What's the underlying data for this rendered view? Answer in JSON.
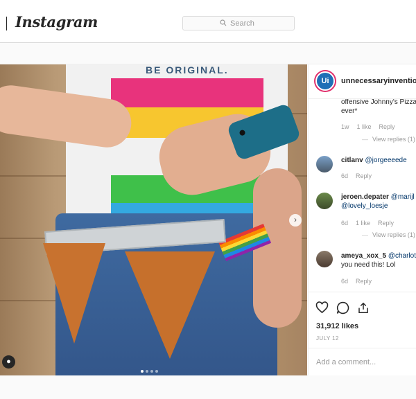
{
  "header": {
    "logo": "Instagram",
    "search_placeholder": "Search",
    "search_icon": "search-icon"
  },
  "post": {
    "shirt_text": "BE ORIGINAL.",
    "carousel": {
      "total": 4,
      "active": 1
    }
  },
  "panel": {
    "avatar_text": "Ui",
    "username": "unnecessaryinventions",
    "comments": [
      {
        "line1": "offensive Johnny's Pizza",
        "line2": "ever*",
        "time": "1w",
        "likes": "1 like",
        "reply": "Reply",
        "view_replies": "View replies (1)"
      },
      {
        "user": "citlanv",
        "text": "@jorgeeeede",
        "time": "6d",
        "reply": "Reply"
      },
      {
        "user": "jeroen.depater",
        "text": "@marijl",
        "line2": "@lovely_loesje",
        "time": "6d",
        "likes": "1 like",
        "reply": "Reply",
        "view_replies": "View replies (1)"
      },
      {
        "user": "ameya_xox_5",
        "text": "@charlot",
        "line2": "you need this! Lol",
        "time": "6d",
        "reply": "Reply"
      }
    ],
    "likes": "31,912 likes",
    "date": "JULY 12",
    "add_comment_placeholder": "Add a comment..."
  },
  "colors": {
    "story_ring": "#e1306c",
    "avatar_bg": "#1f6fb6",
    "mention": "#003569"
  }
}
